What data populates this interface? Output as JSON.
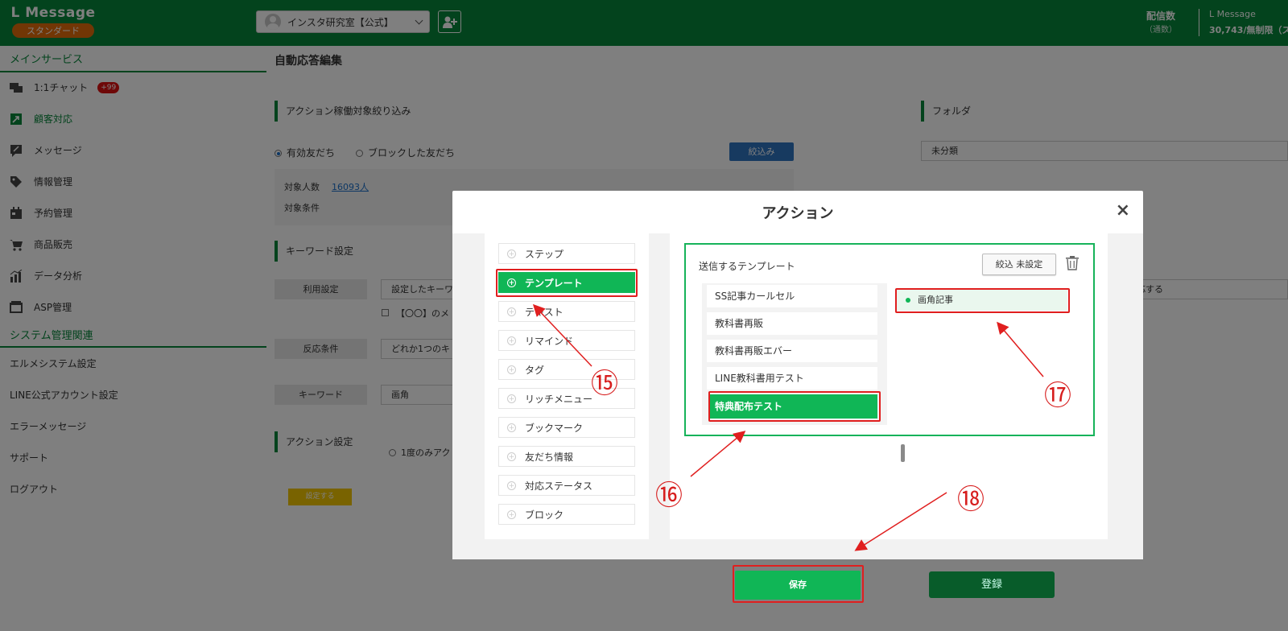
{
  "header": {
    "logo_title": "L Message",
    "logo_badge": "スタンダード",
    "account_name": "インスタ研究室【公式】",
    "send_count_label": "配信数",
    "send_count_sub": "（通数）",
    "plan_label": "L Message",
    "plan_value": "30,743/無制限（ス"
  },
  "sidebar": {
    "section_main": "メインサービス",
    "items": [
      {
        "label": "1:1チャット",
        "icon": "chat-icon",
        "badge": "+99"
      },
      {
        "label": "顧客対応",
        "icon": "customer-icon"
      },
      {
        "label": "メッセージ",
        "icon": "message-icon"
      },
      {
        "label": "情報管理",
        "icon": "tag-icon"
      },
      {
        "label": "予約管理",
        "icon": "calendar-icon"
      },
      {
        "label": "商品販売",
        "icon": "cart-icon"
      },
      {
        "label": "データ分析",
        "icon": "chart-icon"
      },
      {
        "label": "ASP管理",
        "icon": "asp-icon"
      }
    ],
    "section_system": "システム管理関連",
    "system_items": [
      "エルメシステム設定",
      "LINE公式アカウント設定",
      "エラーメッセージ",
      "サポート",
      "ログアウト"
    ]
  },
  "main": {
    "page_title": "自動応答編集",
    "target_section": "アクション稼働対象絞り込み",
    "radio_valid": "有効友だち",
    "radio_blocked": "ブロックした友だち",
    "filter_button": "絞込み",
    "target_count_label": "対象人数",
    "target_count_value": "16093人",
    "target_condition_label": "対象条件",
    "folder_section": "フォルダ",
    "folder_value": "未分類",
    "keyword_section": "キーワード設定",
    "usage_label": "利用設定",
    "usage_value": "設定したキーワ",
    "usage_right": "応する",
    "checkbox_label": "【〇〇】のメ",
    "condition_label": "反応条件",
    "condition_value": "どれか1つのキ",
    "keyword_label": "キーワード",
    "keyword_value": "画角",
    "action_section": "アクション設定",
    "action_radio": "1度のみアク",
    "set_button": "設定する",
    "save_button": "保存",
    "register_button": "登録"
  },
  "modal": {
    "title": "アクション",
    "close": "×",
    "actions": [
      "ステップ",
      "テンプレート",
      "テキスト",
      "リマインド",
      "タグ",
      "リッチメニュー",
      "ブックマーク",
      "友だち情報",
      "対応ステータス",
      "ブロック"
    ],
    "active_action": "テンプレート",
    "template_label": "送信するテンプレート",
    "filter_button": "絞込 未設定",
    "templates": [
      "SS記事カールセル",
      "教科書再販",
      "教科書再販エバー",
      "LINE教科書用テスト",
      "特典配布テスト"
    ],
    "active_template": "特典配布テスト",
    "selected_item": "画角記事"
  },
  "annotations": {
    "n15": "⑮",
    "n16": "⑯",
    "n17": "⑰",
    "n18": "⑱",
    "color": "#e01f1f"
  },
  "colors": {
    "brand_green": "#06873a",
    "button_green": "#10b656",
    "accent_orange": "#e46c0a",
    "link_blue": "#1a6fc9"
  }
}
